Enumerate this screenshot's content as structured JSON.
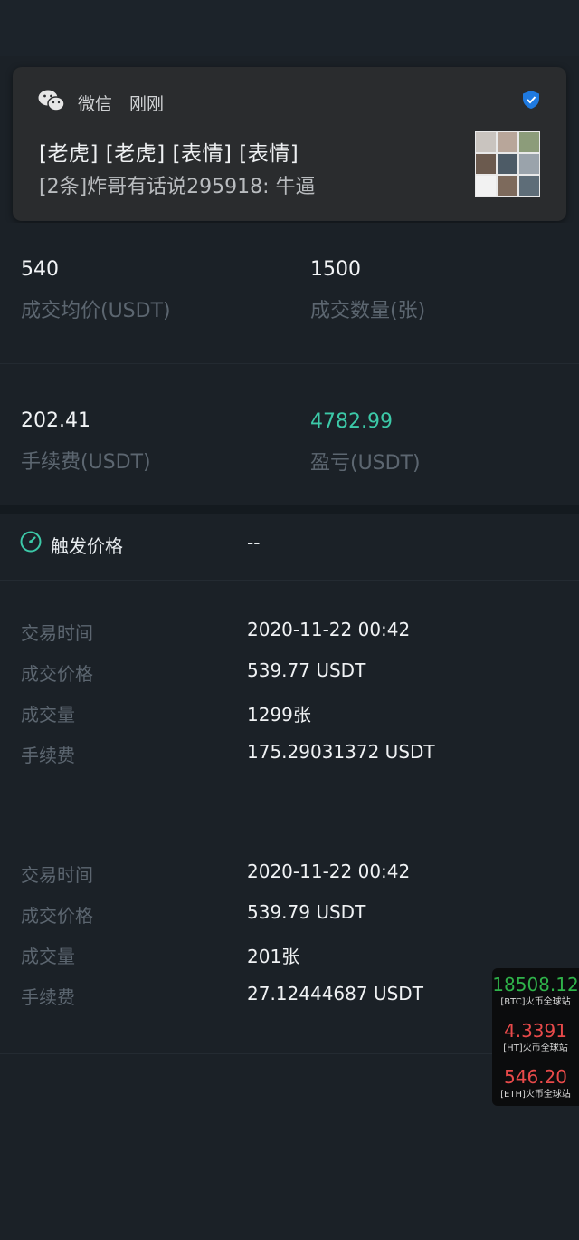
{
  "notification": {
    "app": "微信",
    "time": "刚刚",
    "line1": "[老虎] [老虎] [表情] [表情]",
    "line2": "[2条]炸哥有话说295918: 牛逼"
  },
  "stats": {
    "avg_price": {
      "value": "540",
      "label": "成交均价(USDT)"
    },
    "quantity": {
      "value": "1500",
      "label": "成交数量(张)"
    },
    "fee": {
      "value": "202.41",
      "label": "手续费(USDT)"
    },
    "pnl": {
      "value": "4782.99",
      "label": "盈亏(USDT)"
    }
  },
  "trigger": {
    "label": "触发价格",
    "value": "--"
  },
  "trades": [
    {
      "time_label": "交易时间",
      "time": "2020-11-22 00:42",
      "price_label": "成交价格",
      "price": "539.77 USDT",
      "qty_label": "成交量",
      "qty": "1299张",
      "fee_label": "手续费",
      "fee": "175.29031372 USDT"
    },
    {
      "time_label": "交易时间",
      "time": "2020-11-22 00:42",
      "price_label": "成交价格",
      "price": "539.79 USDT",
      "qty_label": "成交量",
      "qty": "201张",
      "fee_label": "手续费",
      "fee": "27.12444687 USDT"
    }
  ],
  "ticker": [
    {
      "price": "18508.12",
      "source": "[BTC]火币全球站",
      "trend": "up"
    },
    {
      "price": "4.3391",
      "source": "[HT]火币全球站",
      "trend": "down"
    },
    {
      "price": "546.20",
      "source": "[ETH]火币全球站",
      "trend": "down"
    }
  ],
  "colors": {
    "profit": "#3cc9a8",
    "accent": "#1f7ae0",
    "up": "#2fb34a",
    "down": "#e84a4a"
  }
}
